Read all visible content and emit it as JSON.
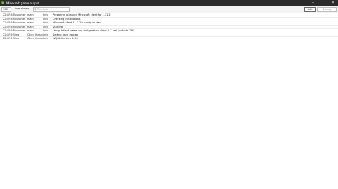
{
  "window": {
    "title": "Minecraft game output"
  },
  "toolbar": {
    "limit_value": "100",
    "limit_label": "Lines shown",
    "filter_placeholder": "Filter text",
    "info_label": "Info",
    "debug_label": "Debug"
  },
  "log": [
    {
      "time": "22:47:58",
      "source": "launcher",
      "thread": "main",
      "level": "Info",
      "message": "Preparing to launch Minecraft client for 1.11.2"
    },
    {
      "time": "22:47:58",
      "source": "launcher",
      "thread": "main",
      "level": "Info",
      "message": "Checking installations"
    },
    {
      "time": "22:47:58",
      "source": "launcher",
      "thread": "main",
      "level": "Info",
      "message": "Minecraft client 1.11.2 is ready to start."
    },
    {
      "time": "22:47:58",
      "source": "launcher",
      "thread": "main",
      "level": "Info",
      "message": "Starting!"
    },
    {
      "time": "22:47:58",
      "source": "launcher",
      "thread": "main",
      "level": "Info",
      "message": "Using default game log configuration client-1.7.xml (outputs XML)"
    },
    {
      "time": "22:47:59",
      "source": "liwc",
      "thread": "Client thread",
      "level": "Info",
      "message": "Setting user: daicea"
    },
    {
      "time": "22:47:59",
      "source": "liwc",
      "thread": "Client thread",
      "level": "Info",
      "message": "LWJGL Version: 2.9.4"
    }
  ]
}
